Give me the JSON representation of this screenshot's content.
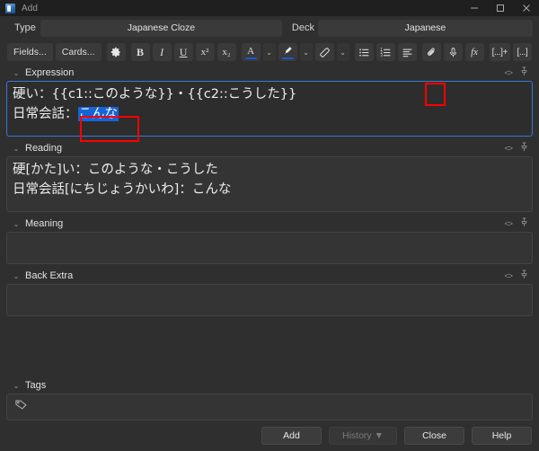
{
  "window": {
    "title": "Add",
    "app_icon": "anki-icon",
    "controls": [
      {
        "name": "minimize",
        "glyph": "minimize-icon"
      },
      {
        "name": "maximize",
        "glyph": "maximize-icon"
      },
      {
        "name": "close",
        "glyph": "close-icon"
      }
    ]
  },
  "notetype_row": {
    "type_label": "Type",
    "type_value": "Japanese Cloze",
    "deck_label": "Deck",
    "deck_value": "Japanese"
  },
  "toolbar": {
    "fields_label": "Fields...",
    "cards_label": "Cards...",
    "settings_icon": "gear-icon",
    "bold": "B",
    "italic": "I",
    "underline": "U",
    "superscript": "x²",
    "subscript": "x₂",
    "text_color": "A",
    "text_color_caret": "⌄",
    "highlight_color_icon": "highlighter-icon",
    "highlight_caret": "⌄",
    "remove_formatting_icon": "eraser-icon",
    "remove_formatting_caret": "⌄",
    "unordered_list_icon": "bulleted-list-icon",
    "ordered_list_icon": "numbered-list-icon",
    "justify_icon": "paragraph-align-icon",
    "attach_icon": "paperclip-icon",
    "record_icon": "microphone-icon",
    "equation_label": "fx",
    "cloze_new_label": "[...]+",
    "cloze_same_label": "[...]",
    "accent_color": "#1558d6",
    "highlight_annotation_color": "#ff0000"
  },
  "fields": [
    {
      "name": "Expression",
      "focused": true,
      "lines": [
        "硬い：{{c1::このような}}・{{c2::こうした}}",
        "日常会話："
      ],
      "selected_text": "こんな",
      "annotated": true,
      "collapse_icon": "chevron-down-icon",
      "html_icon": "html-editor-icon",
      "pin_icon": "pin-icon"
    },
    {
      "name": "Reading",
      "focused": false,
      "lines": [
        "硬[かた]い：このような・こうした",
        "日常会話[にちじょうかいわ]：こんな"
      ],
      "selected_text": "",
      "annotated": false,
      "collapse_icon": "chevron-down-icon",
      "html_icon": "html-editor-icon",
      "pin_icon": "pin-icon"
    },
    {
      "name": "Meaning",
      "focused": false,
      "lines": [],
      "selected_text": "",
      "annotated": false,
      "collapse_icon": "chevron-down-icon",
      "html_icon": "html-editor-icon",
      "pin_icon": "pin-icon"
    },
    {
      "name": "Back Extra",
      "focused": false,
      "lines": [],
      "selected_text": "",
      "annotated": false,
      "collapse_icon": "chevron-down-icon",
      "html_icon": "html-editor-icon",
      "pin_icon": "pin-icon"
    }
  ],
  "tags": {
    "label": "Tags",
    "collapse_icon": "chevron-down-icon",
    "tag_icon": "tag-icon",
    "value": ""
  },
  "bottom_buttons": {
    "add": "Add",
    "history": "History ▼",
    "history_disabled": true,
    "close": "Close",
    "help": "Help"
  }
}
